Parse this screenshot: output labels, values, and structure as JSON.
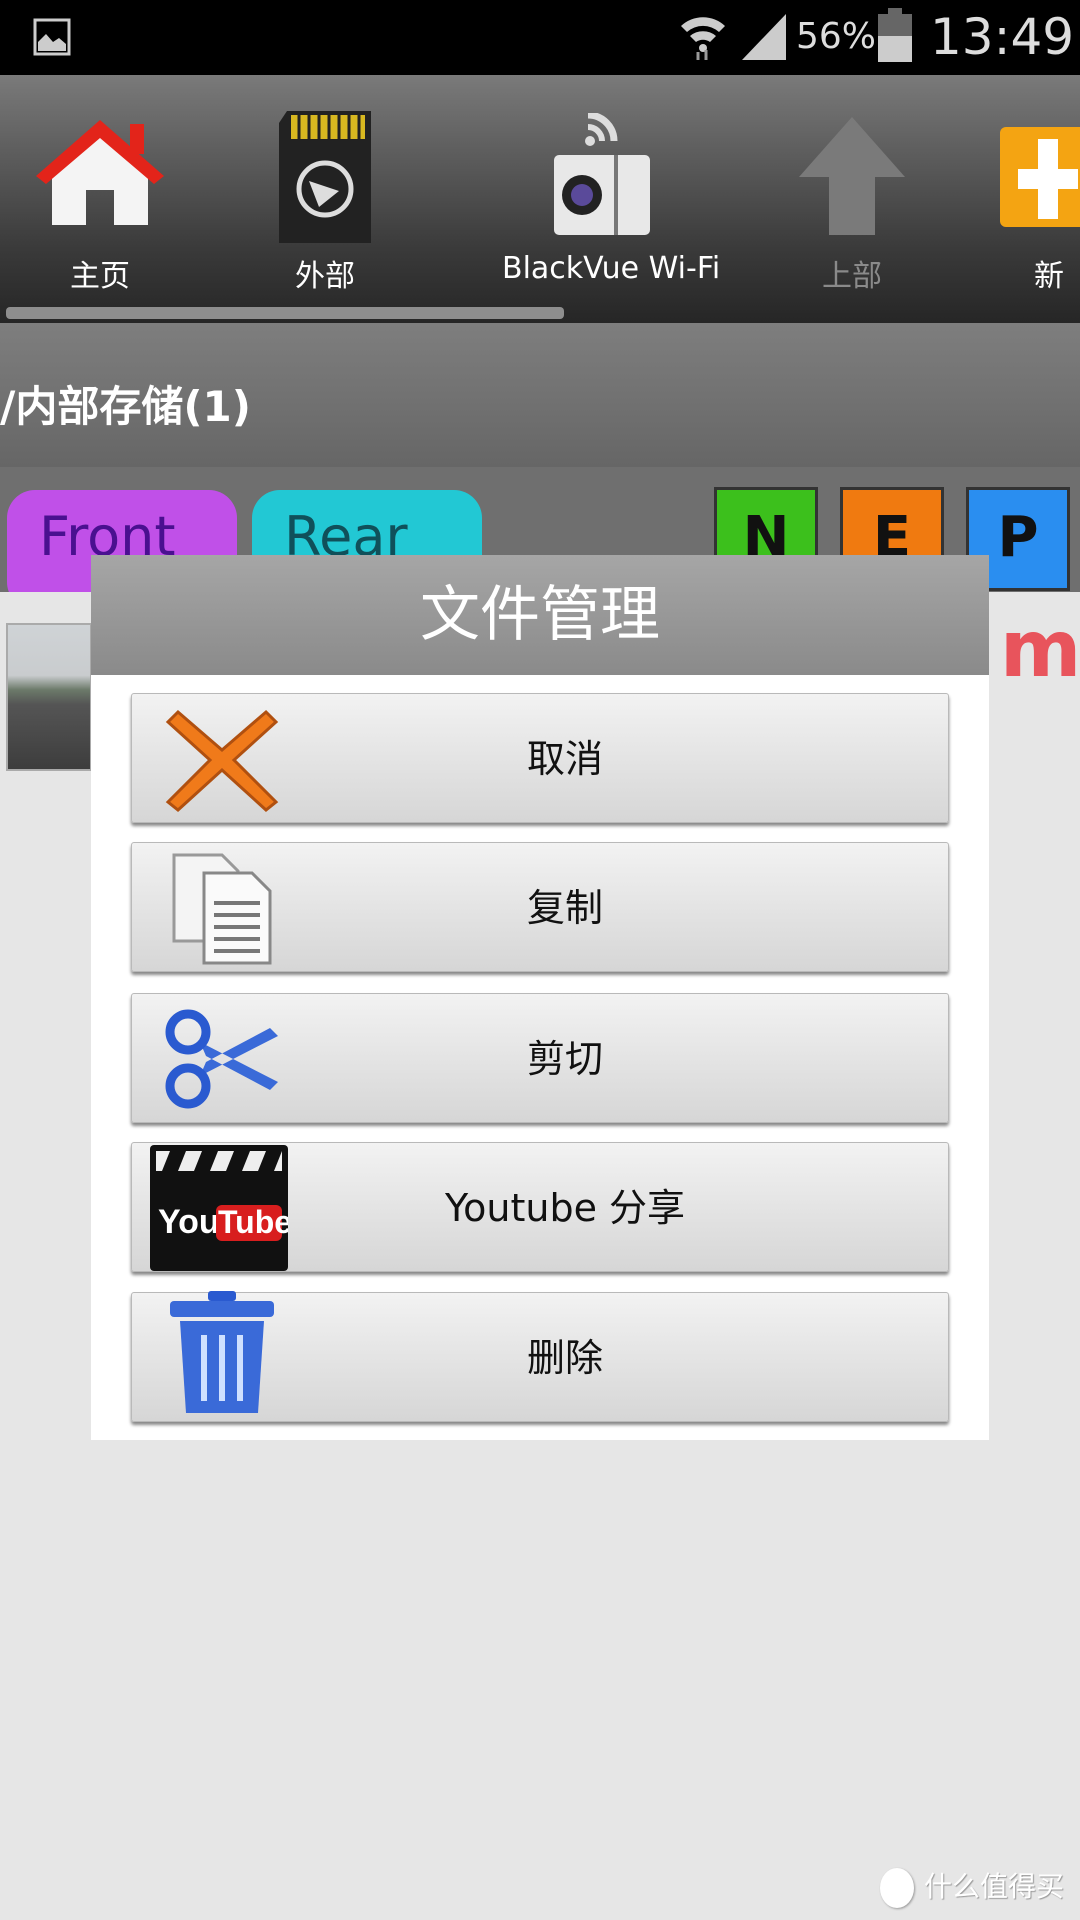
{
  "status_bar": {
    "battery": "56%",
    "time": "13:49",
    "icons": [
      "image-notification-icon",
      "wifi-icon",
      "signal-icon",
      "battery-icon"
    ]
  },
  "toolbar": {
    "items": [
      {
        "label": "主页",
        "icon": "home-icon"
      },
      {
        "label": "外部",
        "icon": "sd-card-icon"
      },
      {
        "label": "BlackVue Wi-Fi",
        "icon": "wifi-camera-icon"
      },
      {
        "label": "上部",
        "icon": "up-arrow-icon",
        "disabled": true
      },
      {
        "label": "新",
        "icon": "new-folder-icon"
      }
    ]
  },
  "path": "/内部存储(1)",
  "tabs": {
    "front": "Front",
    "rear": "Rear",
    "filters": [
      "N",
      "E",
      "P"
    ]
  },
  "colors": {
    "front": "#c050e8",
    "rear": "#22c8d4",
    "n": "#3cc01c",
    "e": "#f07a10",
    "p": "#2a8ef0",
    "accent_red": "#e8545c"
  },
  "list_partial": "m",
  "dialog": {
    "title": "文件管理",
    "buttons": [
      {
        "label": "取消",
        "icon": "cancel-x-icon"
      },
      {
        "label": "复制",
        "icon": "copy-icon"
      },
      {
        "label": "剪切",
        "icon": "scissors-icon"
      },
      {
        "label": "Youtube 分享",
        "icon": "youtube-icon"
      },
      {
        "label": "删除",
        "icon": "trash-icon"
      }
    ]
  },
  "watermark": "什么值得买"
}
